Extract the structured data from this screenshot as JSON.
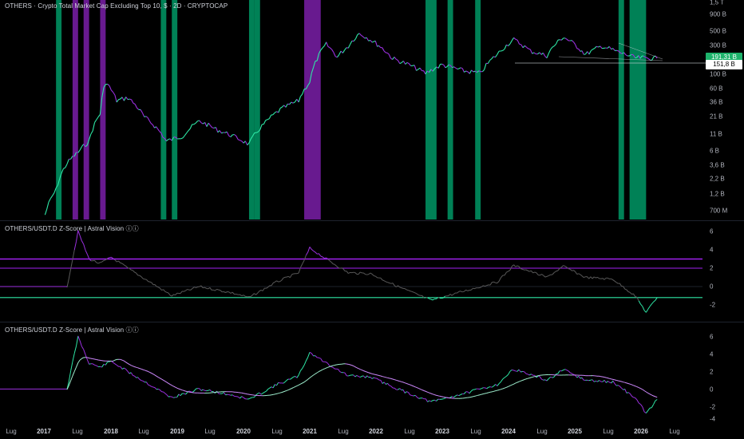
{
  "colors": {
    "background": "#000000",
    "green": "#2ee8a6",
    "purple": "#9b30e0",
    "green_zone": "#008f5f",
    "purple_zone": "#7a1fa8",
    "band_line": "#a020f0",
    "gray_line": "#5a5a5a",
    "last_price_bg": "#1db36b",
    "support_line": "#d1d4dc"
  },
  "main_pane": {
    "title": "OTHERS · Crypto Total Market Cap Excluding Top 10, $ · 2D · CRYPTOCAP",
    "scale_labels": [
      "1,5 T",
      "900 B",
      "500 B",
      "300 B",
      "100 B",
      "60 B",
      "36 B",
      "21 B",
      "11 B",
      "6 B",
      "3,6 B",
      "2,2 B",
      "1,2 B",
      "700 M"
    ],
    "last_price": "191,31 B",
    "support_price": "151,8 B"
  },
  "zscore_pane": {
    "title": "OTHERS/USDT.D Z-Score | Astral Vision ⓘⓘ",
    "scale_labels": [
      "6",
      "4",
      "2",
      "0",
      "-2"
    ],
    "upper_band": 3,
    "mid_band": 2,
    "lower_band": -1.2
  },
  "zscore_ma_pane": {
    "title": "OTHERS/USDT.D Z-Score | Astral Vision ⓘⓘ",
    "scale_labels": [
      "6",
      "4",
      "2",
      "0",
      "-2",
      "-4"
    ]
  },
  "time_axis": [
    "Lug",
    "2017",
    "Lug",
    "2018",
    "Lug",
    "2019",
    "Lug",
    "2020",
    "Lug",
    "2021",
    "Lug",
    "2022",
    "Lug",
    "2023",
    "Lug",
    "2024",
    "Lug",
    "2025",
    "Lug",
    "2026",
    "Lug"
  ],
  "chart_data": {
    "type": "line",
    "title": "OTHERS · Crypto Total Market Cap Excluding Top 10, $ · 2D · CRYPTOCAP",
    "x_range": [
      "2016-07",
      "2026-07"
    ],
    "series": [
      {
        "name": "OTHERS",
        "unit": "USD",
        "points": [
          [
            "2017-02",
            600000000.0
          ],
          [
            "2017-04",
            1500000000.0
          ],
          [
            "2017-06",
            4000000000.0
          ],
          [
            "2017-08",
            6000000000.0
          ],
          [
            "2017-10",
            9000000000.0
          ],
          [
            "2017-12",
            25000000000.0
          ],
          [
            "2018-01",
            80000000000.0
          ],
          [
            "2018-03",
            40000000000.0
          ],
          [
            "2018-05",
            45000000000.0
          ],
          [
            "2018-08",
            22000000000.0
          ],
          [
            "2018-12",
            9000000000.0
          ],
          [
            "2019-03",
            11000000000.0
          ],
          [
            "2019-06",
            19000000000.0
          ],
          [
            "2019-09",
            14000000000.0
          ],
          [
            "2019-12",
            11000000000.0
          ],
          [
            "2020-03",
            8000000000.0
          ],
          [
            "2020-06",
            18000000000.0
          ],
          [
            "2020-09",
            30000000000.0
          ],
          [
            "2020-12",
            40000000000.0
          ],
          [
            "2021-02",
            80000000000.0
          ],
          [
            "2021-05",
            320000000000.0
          ],
          [
            "2021-07",
            200000000000.0
          ],
          [
            "2021-09",
            300000000000.0
          ],
          [
            "2021-11",
            480000000000.0
          ],
          [
            "2022-01",
            380000000000.0
          ],
          [
            "2022-05",
            190000000000.0
          ],
          [
            "2022-08",
            150000000000.0
          ],
          [
            "2022-11",
            110000000000.0
          ],
          [
            "2023-02",
            150000000000.0
          ],
          [
            "2023-06",
            120000000000.0
          ],
          [
            "2023-09",
            110000000000.0
          ],
          [
            "2023-12",
            220000000000.0
          ],
          [
            "2024-03",
            380000000000.0
          ],
          [
            "2024-06",
            250000000000.0
          ],
          [
            "2024-09",
            210000000000.0
          ],
          [
            "2024-12",
            420000000000.0
          ],
          [
            "2025-04",
            220000000000.0
          ],
          [
            "2025-07",
            300000000000.0
          ],
          [
            "2025-10",
            240000000000.0
          ],
          [
            "2026-01",
            195000000000.0
          ],
          [
            "2026-05",
            191310000000.0
          ]
        ]
      },
      {
        "name": "OTHERS/USDT.D Z-Score",
        "points": [
          [
            "2017-06",
            0
          ],
          [
            "2017-08",
            6
          ],
          [
            "2017-10",
            3
          ],
          [
            "2017-12",
            2.5
          ],
          [
            "2018-02",
            3.2
          ],
          [
            "2018-05",
            2
          ],
          [
            "2018-09",
            0.5
          ],
          [
            "2019-01",
            -1
          ],
          [
            "2019-06",
            0
          ],
          [
            "2019-12",
            -0.7
          ],
          [
            "2020-03",
            -1.2
          ],
          [
            "2020-08",
            0.5
          ],
          [
            "2020-12",
            1.5
          ],
          [
            "2021-02",
            4.2
          ],
          [
            "2021-05",
            3
          ],
          [
            "2021-09",
            1.5
          ],
          [
            "2022-01",
            1.4
          ],
          [
            "2022-06",
            0
          ],
          [
            "2022-12",
            -1.5
          ],
          [
            "2023-06",
            -0.5
          ],
          [
            "2023-12",
            0.5
          ],
          [
            "2024-03",
            2.3
          ],
          [
            "2024-09",
            1
          ],
          [
            "2024-12",
            2.2
          ],
          [
            "2025-04",
            1
          ],
          [
            "2025-09",
            0.8
          ],
          [
            "2026-01",
            -1
          ],
          [
            "2026-03",
            -2.8
          ],
          [
            "2026-05",
            -1.2
          ]
        ]
      }
    ],
    "log_scale": true,
    "legend": "none"
  }
}
